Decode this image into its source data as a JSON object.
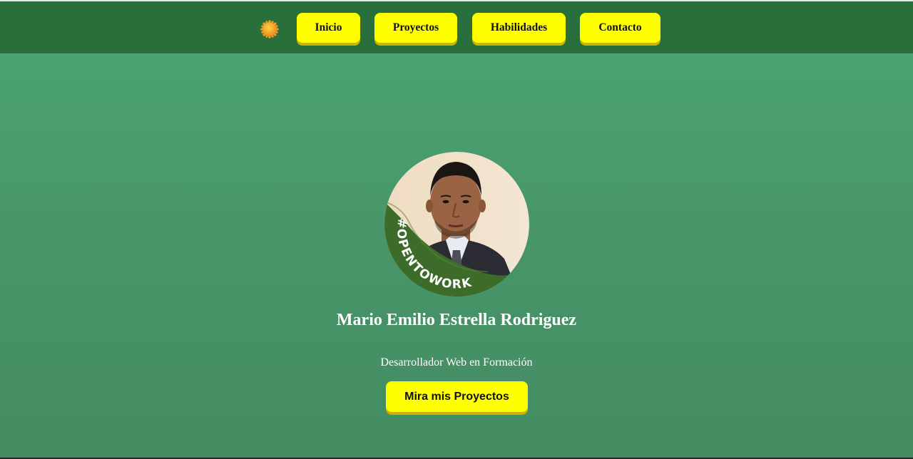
{
  "nav": {
    "theme_icon": "sun-icon",
    "items": [
      {
        "label": "Inicio"
      },
      {
        "label": "Proyectos"
      },
      {
        "label": "Habilidades"
      },
      {
        "label": "Contacto"
      }
    ]
  },
  "hero": {
    "avatar_badge": "#OPENTOWORK",
    "name": "Mario Emilio Estrella Rodriguez",
    "role": "Desarrollador Web en Formación",
    "cta_label": "Mira mis Proyectos"
  },
  "colors": {
    "navbar": "#296f3b",
    "background": "#4ca674",
    "button": "#ffff00",
    "button_shadow": "#c9b400",
    "text_light": "#ffffff",
    "badge_green": "#3d6b2a"
  }
}
